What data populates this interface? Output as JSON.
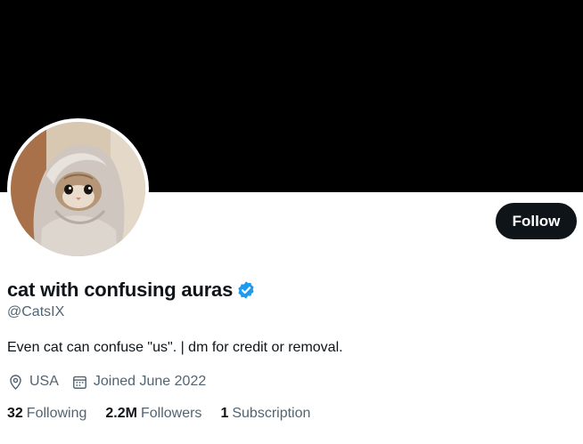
{
  "profile": {
    "display_name": "cat with confusing auras",
    "handle": "@CatsIX",
    "bio": "Even cat can confuse \"us\". | dm for credit or removal.",
    "verified": true,
    "avatar_icon": "cat-wrapped-in-blanket",
    "location": "USA",
    "joined": "Joined June 2022"
  },
  "actions": {
    "follow_label": "Follow"
  },
  "stats": {
    "following_count": "32",
    "following_label": "Following",
    "followers_count": "2.2M",
    "followers_label": "Followers",
    "subscription_count": "1",
    "subscription_label": "Subscription"
  },
  "icons": {
    "verified": "verified-badge-icon",
    "location": "location-pin-icon",
    "calendar": "calendar-icon"
  },
  "colors": {
    "banner": "#000000",
    "button_bg": "#0f1419",
    "verified_blue": "#1d9bf0",
    "secondary_text": "#536471",
    "primary_text": "#0f1419"
  }
}
